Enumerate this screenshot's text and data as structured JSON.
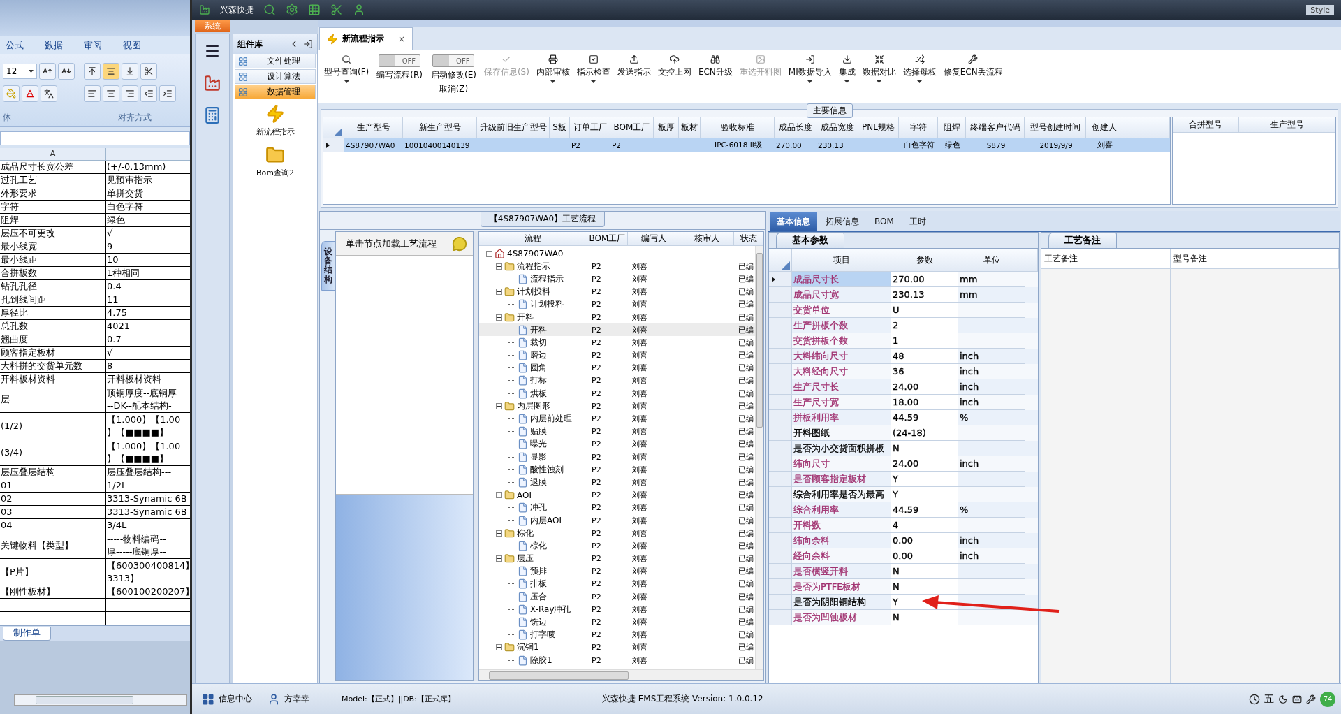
{
  "excel": {
    "tabs": [
      "公式",
      "数据",
      "审阅",
      "视图"
    ],
    "font_size": "12",
    "font_group": "体",
    "align_group": "对齐方式",
    "column_header": "A",
    "sheet_tab": "制作单",
    "rows": [
      {
        "a": "成品尺寸长宽公差",
        "b": "(+/-0.13mm)"
      },
      {
        "a": "过孔工艺",
        "b": "见预审指示"
      },
      {
        "a": "外形要求",
        "b": "单拼交货"
      },
      {
        "a": "字符",
        "b": "白色字符"
      },
      {
        "a": "阻焊",
        "b": "绿色"
      },
      {
        "a": "层压不可更改",
        "b": "√"
      },
      {
        "a": "最小线宽",
        "b": "9"
      },
      {
        "a": "最小线距",
        "b": "10"
      },
      {
        "a": "合拼板数",
        "b": "1种相同"
      },
      {
        "a": "钻孔孔径",
        "b": "0.4"
      },
      {
        "a": "孔到线间距",
        "b": "11"
      },
      {
        "a": "厚径比",
        "b": "4.75"
      },
      {
        "a": "总孔数",
        "b": "4021"
      },
      {
        "a": "翘曲度",
        "b": "0.7"
      },
      {
        "a": "顾客指定板材",
        "b": "√"
      },
      {
        "a": "大料拼的交货单元数",
        "b": "8"
      },
      {
        "a": "开料板材资料",
        "b": "开料板材资料"
      },
      {
        "a": "层",
        "b": "顶铜厚度--底铜厚\n--DK--配本结构-"
      },
      {
        "a": "(1/2)",
        "b": "【1.000】【1.00\n】【■■■■】"
      },
      {
        "a": "(3/4)",
        "b": "【1.000】【1.00\n】【■■■■】"
      },
      {
        "a": "层压叠层结构",
        "b": "层压叠层结构---"
      },
      {
        "a": "01",
        "b": "1/2L"
      },
      {
        "a": "02",
        "b": "3313-Synamic 6B"
      },
      {
        "a": "03",
        "b": "3313-Synamic 6B"
      },
      {
        "a": "04",
        "b": "3/4L"
      },
      {
        "a": "关键物料【类型】",
        "b": "-----物料编码--\n厚-----底铜厚--"
      },
      {
        "a": "【P片】",
        "b": "【600300400814】\n3313】"
      },
      {
        "a": "【刚性板材】",
        "b": "【600100200207】"
      }
    ]
  },
  "app": {
    "title": "兴森快捷",
    "system_tab": "系统",
    "style": "Style"
  },
  "component_library": {
    "title": "组件库",
    "items": [
      {
        "label": "文件处理",
        "selected": false
      },
      {
        "label": "设计算法",
        "selected": false
      },
      {
        "label": "数据管理",
        "selected": true
      }
    ],
    "shortcuts": [
      {
        "label": "新流程指示",
        "kind": "bolt"
      },
      {
        "label": "Bom查询2",
        "kind": "folder"
      }
    ]
  },
  "document_tab": {
    "label": "新流程指示",
    "close": "×"
  },
  "toolbar": [
    {
      "kind": "button",
      "label": "型号查询(F)",
      "dropdown": true,
      "disabled": false
    },
    {
      "kind": "toggle",
      "state": "OFF",
      "on": false,
      "label": "编写流程(R)"
    },
    {
      "kind": "toggle",
      "state": "OFF",
      "on": false,
      "label": "启动修改(E)",
      "sub_label": "取消(Z)"
    },
    {
      "kind": "button",
      "label": "保存信息(S)",
      "dropdown": false,
      "disabled": true
    },
    {
      "kind": "button",
      "label": "内部审核",
      "dropdown": true,
      "disabled": false
    },
    {
      "kind": "button",
      "label": "指示检查",
      "dropdown": true,
      "disabled": false
    },
    {
      "kind": "button",
      "label": "发送指示",
      "dropdown": false,
      "disabled": false
    },
    {
      "kind": "button",
      "label": "文控上网",
      "dropdown": false,
      "disabled": false
    },
    {
      "kind": "button",
      "label": "ECN升级",
      "dropdown": false,
      "disabled": false
    },
    {
      "kind": "button",
      "label": "重选开料图",
      "dropdown": false,
      "disabled": true
    },
    {
      "kind": "button",
      "label": "MI数据导入",
      "dropdown": true,
      "disabled": false
    },
    {
      "kind": "button",
      "label": "集成",
      "dropdown": true,
      "disabled": false
    },
    {
      "kind": "button",
      "label": "数据对比",
      "dropdown": true,
      "disabled": false
    },
    {
      "kind": "button",
      "label": "选择母板",
      "dropdown": true,
      "disabled": false
    },
    {
      "kind": "button",
      "label": "修复ECN丢流程",
      "dropdown": false,
      "disabled": false
    }
  ],
  "main_info": {
    "title": "主要信息",
    "columns": [
      "生产型号",
      "新生产型号",
      "升级前旧生产型号",
      "S板",
      "订单工厂",
      "BOM工厂",
      "板厚",
      "板材",
      "验收标准",
      "成品长度",
      "成品宽度",
      "PNL规格",
      "字符",
      "阻焊",
      "终端客户代码",
      "型号创建时间",
      "创建人"
    ],
    "rows": [
      {
        "selected": true,
        "cells": [
          "4S87907WA0",
          "10010400140139",
          null,
          null,
          "P2",
          "P2",
          null,
          null,
          "IPC-6018 II级",
          "270.00",
          "230.13",
          null,
          "白色字符",
          "绿色",
          "S879",
          "2019/9/9",
          "刘喜"
        ]
      }
    ],
    "side_columns": [
      "合拼型号",
      "生产型号"
    ]
  },
  "process_flow": {
    "title": "【4S87907WA0】工艺流程",
    "side_tab": "设备结构",
    "hint": "单击节点加载工艺流程",
    "columns": [
      "流程",
      "BOM工厂",
      "编写人",
      "核审人",
      "状态"
    ],
    "tree": [
      {
        "name": "4S87907WA0",
        "kind": "root",
        "selected": false,
        "expanded": true,
        "children": [
          {
            "name": "流程指示",
            "kind": "folder",
            "bom": "P2",
            "writer": "刘喜",
            "status": "已编",
            "selected": false,
            "expanded": true,
            "children": [
              {
                "name": "流程指示",
                "kind": "file",
                "bom": "P2",
                "writer": "刘喜",
                "status": "已编",
                "selected": false
              }
            ]
          },
          {
            "name": "计划投料",
            "kind": "folder",
            "bom": "P2",
            "writer": "刘喜",
            "status": "已编",
            "selected": false,
            "expanded": true,
            "children": [
              {
                "name": "计划投料",
                "kind": "file",
                "bom": "P2",
                "writer": "刘喜",
                "status": "已编",
                "selected": false
              }
            ]
          },
          {
            "name": "开料",
            "kind": "folder",
            "bom": "P2",
            "writer": "刘喜",
            "status": "已编",
            "selected": false,
            "expanded": true,
            "children": [
              {
                "name": "开料",
                "kind": "file",
                "bom": "P2",
                "writer": "刘喜",
                "status": "已编",
                "selected": true
              },
              {
                "name": "裁切",
                "kind": "file",
                "bom": "P2",
                "writer": "刘喜",
                "status": "已编",
                "selected": false
              },
              {
                "name": "磨边",
                "kind": "file",
                "bom": "P2",
                "writer": "刘喜",
                "status": "已编",
                "selected": false
              },
              {
                "name": "圆角",
                "kind": "file",
                "bom": "P2",
                "writer": "刘喜",
                "status": "已编",
                "selected": false
              },
              {
                "name": "打标",
                "kind": "file",
                "bom": "P2",
                "writer": "刘喜",
                "status": "已编",
                "selected": false
              },
              {
                "name": "烘板",
                "kind": "file",
                "bom": "P2",
                "writer": "刘喜",
                "status": "已编",
                "selected": false
              }
            ]
          },
          {
            "name": "内层图形",
            "kind": "folder",
            "bom": "P2",
            "writer": "刘喜",
            "status": "已编",
            "selected": false,
            "expanded": true,
            "children": [
              {
                "name": "内层前处理",
                "kind": "file",
                "bom": "P2",
                "writer": "刘喜",
                "status": "已编",
                "selected": false
              },
              {
                "name": "贴膜",
                "kind": "file",
                "bom": "P2",
                "writer": "刘喜",
                "status": "已编",
                "selected": false
              },
              {
                "name": "曝光",
                "kind": "file",
                "bom": "P2",
                "writer": "刘喜",
                "status": "已编",
                "selected": false
              },
              {
                "name": "显影",
                "kind": "file",
                "bom": "P2",
                "writer": "刘喜",
                "status": "已编",
                "selected": false
              },
              {
                "name": "酸性蚀刻",
                "kind": "file",
                "bom": "P2",
                "writer": "刘喜",
                "status": "已编",
                "selected": false
              },
              {
                "name": "退膜",
                "kind": "file",
                "bom": "P2",
                "writer": "刘喜",
                "status": "已编",
                "selected": false
              }
            ]
          },
          {
            "name": "AOI",
            "kind": "folder",
            "bom": "P2",
            "writer": "刘喜",
            "status": "已编",
            "selected": false,
            "expanded": true,
            "children": [
              {
                "name": "冲孔",
                "kind": "file",
                "bom": "P2",
                "writer": "刘喜",
                "status": "已编",
                "selected": false
              },
              {
                "name": "内层AOI",
                "kind": "file",
                "bom": "P2",
                "writer": "刘喜",
                "status": "已编",
                "selected": false
              }
            ]
          },
          {
            "name": "棕化",
            "kind": "folder",
            "bom": "P2",
            "writer": "刘喜",
            "status": "已编",
            "selected": false,
            "expanded": true,
            "children": [
              {
                "name": "棕化",
                "kind": "file",
                "bom": "P2",
                "writer": "刘喜",
                "status": "已编",
                "selected": false
              }
            ]
          },
          {
            "name": "层压",
            "kind": "folder",
            "bom": "P2",
            "writer": "刘喜",
            "status": "已编",
            "selected": false,
            "expanded": true,
            "children": [
              {
                "name": "预排",
                "kind": "file",
                "bom": "P2",
                "writer": "刘喜",
                "status": "已编",
                "selected": false
              },
              {
                "name": "排板",
                "kind": "file",
                "bom": "P2",
                "writer": "刘喜",
                "status": "已编",
                "selected": false
              },
              {
                "name": "压合",
                "kind": "file",
                "bom": "P2",
                "writer": "刘喜",
                "status": "已编",
                "selected": false
              },
              {
                "name": "X-Ray冲孔",
                "kind": "file",
                "bom": "P2",
                "writer": "刘喜",
                "status": "已编",
                "selected": false
              },
              {
                "name": "铣边",
                "kind": "file",
                "bom": "P2",
                "writer": "刘喜",
                "status": "已编",
                "selected": false
              },
              {
                "name": "打字唛",
                "kind": "file",
                "bom": "P2",
                "writer": "刘喜",
                "status": "已编",
                "selected": false
              }
            ]
          },
          {
            "name": "沉铜1",
            "kind": "folder",
            "bom": "P2",
            "writer": "刘喜",
            "status": "已编",
            "selected": false,
            "expanded": true,
            "children": [
              {
                "name": "除胶1",
                "kind": "file",
                "bom": "P2",
                "writer": "刘喜",
                "status": "已编",
                "selected": false
              }
            ]
          }
        ]
      }
    ]
  },
  "basic_info": {
    "tabs": [
      {
        "label": "基本信息",
        "selected": true
      },
      {
        "label": "拓展信息",
        "selected": false
      },
      {
        "label": "BOM",
        "selected": false
      },
      {
        "label": "工时",
        "selected": false
      }
    ],
    "section": "基本参数",
    "columns": [
      "项目",
      "参数",
      "单位"
    ],
    "rows": [
      {
        "item": "成品尺寸长",
        "value": "270.00",
        "unit": "mm",
        "color": "#a0306f",
        "selected": true
      },
      {
        "item": "成品尺寸宽",
        "value": "230.13",
        "unit": "mm",
        "color": "#a0306f",
        "selected": false
      },
      {
        "item": "交货单位",
        "value": "U",
        "color": "#a0306f",
        "selected": false
      },
      {
        "item": "生产拼板个数",
        "value": "2",
        "color": "#a0306f",
        "selected": false
      },
      {
        "item": "交货拼板个数",
        "value": "1",
        "color": "#a0306f",
        "selected": false
      },
      {
        "item": "大料纬向尺寸",
        "value": "48",
        "unit": "inch",
        "color": "#a0306f",
        "selected": false
      },
      {
        "item": "大料经向尺寸",
        "value": "36",
        "unit": "inch",
        "color": "#a0306f",
        "selected": false
      },
      {
        "item": "生产尺寸长",
        "value": "24.00",
        "unit": "inch",
        "color": "#a0306f",
        "selected": false
      },
      {
        "item": "生产尺寸宽",
        "value": "18.00",
        "unit": "inch",
        "color": "#a0306f",
        "selected": false
      },
      {
        "item": "拼板利用率",
        "value": "44.59",
        "unit": "%",
        "color": "#a0306f",
        "selected": false
      },
      {
        "item": "开料图纸",
        "value": "(24-18)",
        "color": "#000000",
        "selected": false
      },
      {
        "item": "是否为小交货面积拼板",
        "value": "N",
        "color": "#000000",
        "selected": false
      },
      {
        "item": "纬向尺寸",
        "value": "24.00",
        "unit": "inch",
        "color": "#a0306f",
        "selected": false
      },
      {
        "item": "是否顾客指定板材",
        "value": "Y",
        "color": "#a0306f",
        "selected": false
      },
      {
        "item": "综合利用率是否为最高",
        "value": "Y",
        "color": "#000000",
        "selected": false
      },
      {
        "item": "综合利用率",
        "value": "44.59",
        "unit": "%",
        "color": "#a0306f",
        "selected": false
      },
      {
        "item": "开料数",
        "value": "4",
        "color": "#a0306f",
        "selected": false
      },
      {
        "item": "纬向余料",
        "value": "0.00",
        "unit": "inch",
        "color": "#a0306f",
        "selected": false
      },
      {
        "item": "经向余料",
        "value": "0.00",
        "unit": "inch",
        "color": "#a0306f",
        "selected": false
      },
      {
        "item": "是否横竖开料",
        "value": "N",
        "color": "#a0306f",
        "selected": false
      },
      {
        "item": "是否为PTFE板材",
        "value": "N",
        "color": "#a0306f",
        "selected": false
      },
      {
        "item": "是否为阴阳铜结构",
        "value": "Y",
        "color": "#000000",
        "selected": false
      },
      {
        "item": "是否为凹蚀板材",
        "value": "N",
        "color": "#a0306f",
        "selected": false
      }
    ]
  },
  "notes": {
    "tab": "工艺备注",
    "columns": [
      "工艺备注",
      "型号备注"
    ]
  },
  "status_bar": {
    "info_center": "信息中心",
    "user": "方幸幸",
    "model": "Model:【正式】||DB:【正式库】",
    "version": "兴森快捷 EMS工程系统 Version: 1.0.0.12",
    "ime": "五",
    "badge": "74"
  }
}
